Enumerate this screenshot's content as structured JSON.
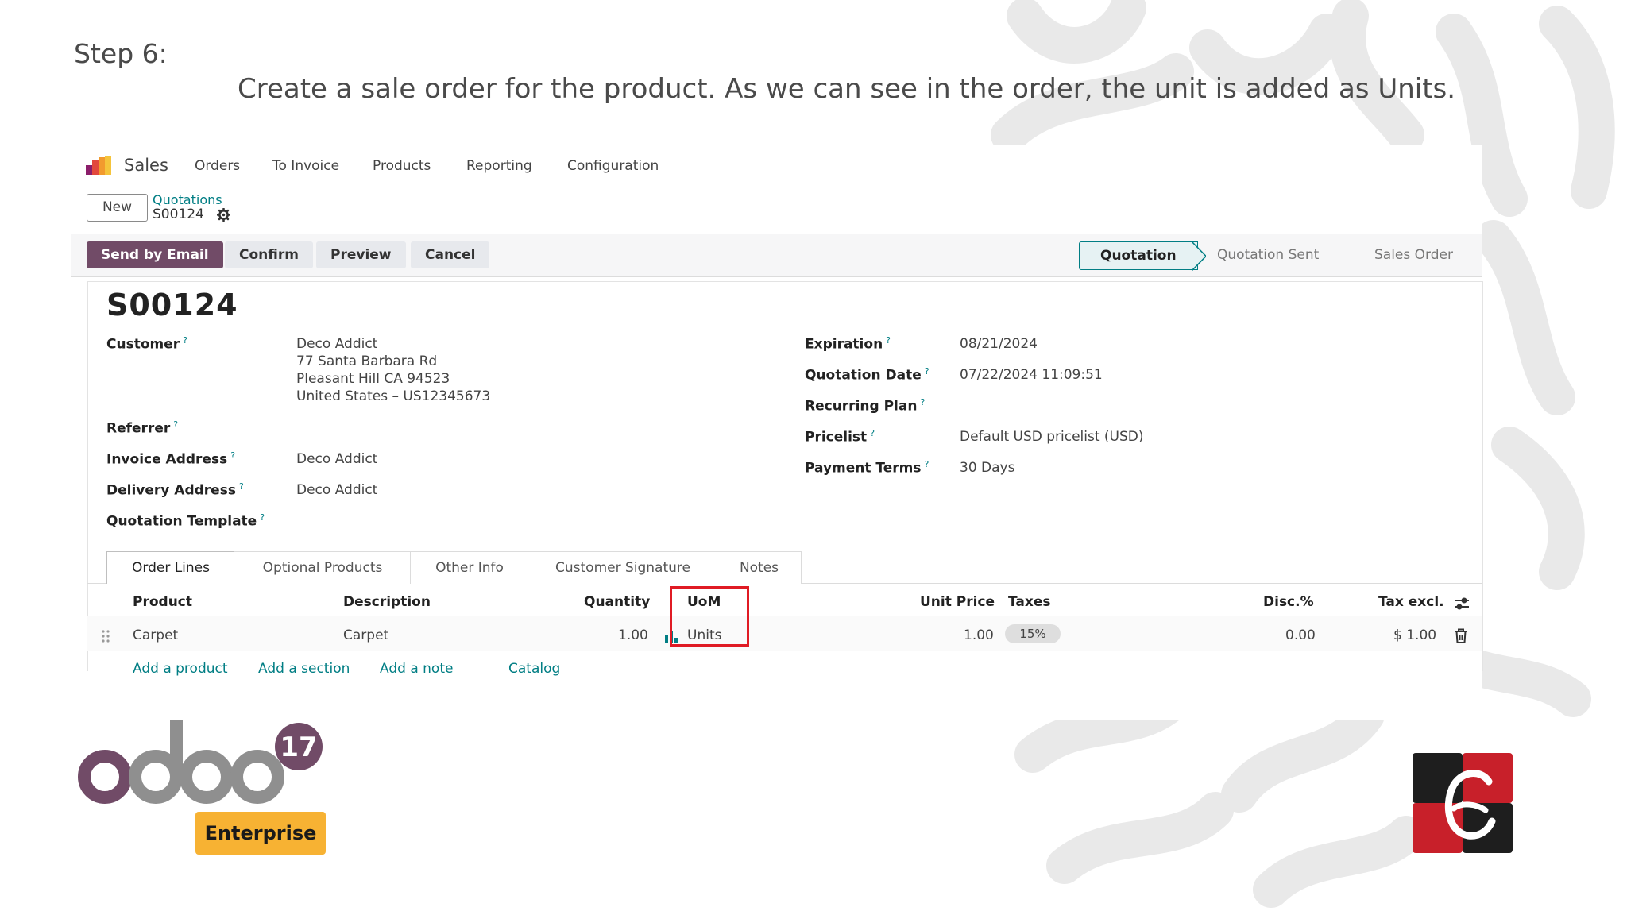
{
  "slide": {
    "step_title": "Step 6:",
    "step_description": "Create a sale order for the product. As we can see in the order, the unit is added as Units."
  },
  "nav": {
    "app_name": "Sales",
    "items": [
      "Orders",
      "To Invoice",
      "Products",
      "Reporting",
      "Configuration"
    ]
  },
  "breadcrumb": {
    "new_label": "New",
    "parent": "Quotations",
    "current": "S00124"
  },
  "actions": [
    "Send by Email",
    "Confirm",
    "Preview",
    "Cancel"
  ],
  "status_bar": [
    "Quotation",
    "Quotation Sent",
    "Sales Order"
  ],
  "order": {
    "name": "S00124",
    "left_fields": [
      {
        "label": "Customer",
        "value": [
          "Deco Addict",
          "77 Santa Barbara Rd",
          "Pleasant Hill CA 94523",
          "United States – US12345673"
        ]
      },
      {
        "label": "Referrer",
        "value": []
      },
      {
        "label": "Invoice Address",
        "value": [
          "Deco Addict"
        ]
      },
      {
        "label": "Delivery Address",
        "value": [
          "Deco Addict"
        ]
      },
      {
        "label": "Quotation Template",
        "value": []
      }
    ],
    "right_fields": [
      {
        "label": "Expiration",
        "value": "08/21/2024"
      },
      {
        "label": "Quotation Date",
        "value": "07/22/2024 11:09:51"
      },
      {
        "label": "Recurring Plan",
        "value": ""
      },
      {
        "label": "Pricelist",
        "value": "Default USD pricelist (USD)"
      },
      {
        "label": "Payment Terms",
        "value": "30 Days"
      }
    ],
    "help_marker": "?"
  },
  "tabs": [
    "Order Lines",
    "Optional Products",
    "Other Info",
    "Customer Signature",
    "Notes"
  ],
  "order_lines": {
    "headers": {
      "product": "Product",
      "description": "Description",
      "quantity": "Quantity",
      "uom": "UoM",
      "unit_price": "Unit Price",
      "taxes": "Taxes",
      "discount": "Disc.%",
      "tax_excl": "Tax excl."
    },
    "rows": [
      {
        "product": "Carpet",
        "description": "Carpet",
        "quantity": "1.00",
        "uom": "Units",
        "unit_price": "1.00",
        "taxes": "15%",
        "discount": "0.00",
        "tax_excl": "$ 1.00"
      }
    ],
    "links": [
      "Add a product",
      "Add a section",
      "Add a note",
      "Catalog"
    ]
  },
  "branding": {
    "odoo_version": "17",
    "edition": "Enterprise",
    "accent": "#714b67",
    "teal": "#017e84",
    "highlight": "#e01b24"
  }
}
